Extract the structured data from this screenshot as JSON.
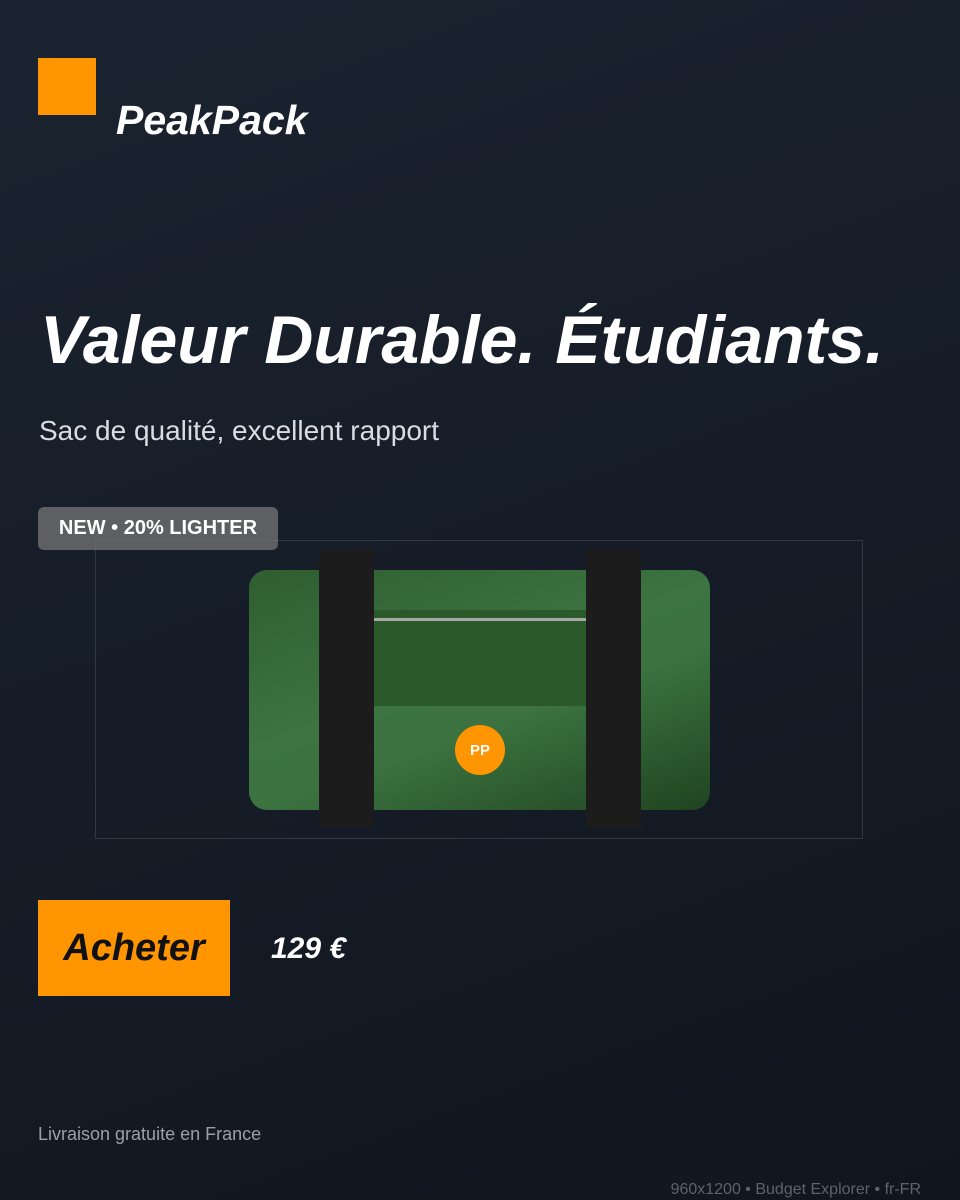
{
  "brand": {
    "name": "PeakPack",
    "logo_color": "#ff9500"
  },
  "hero": {
    "headline": "Valeur Durable. Étudiants.",
    "subheadline": "Sac de qualité, excellent rapport"
  },
  "product": {
    "badge": "NEW • 20% LIGHTER",
    "bag_logo_text": "PP",
    "bag_color": "#3b7240"
  },
  "cta": {
    "buy_label": "Acheter",
    "price": "129 €",
    "accent": "#ff9500"
  },
  "footer": {
    "shipping_note": "Livraison gratuite en France",
    "meta": "960x1200 • Budget Explorer • fr-FR"
  }
}
